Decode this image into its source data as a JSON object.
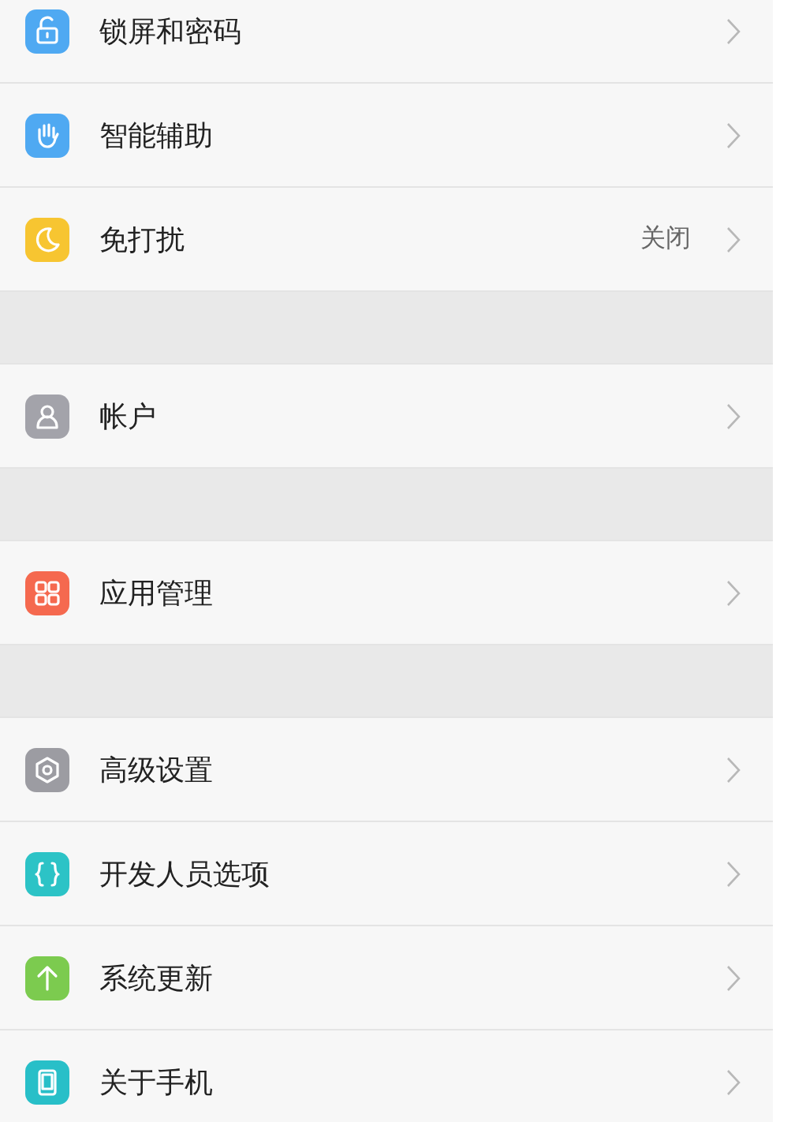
{
  "groups": [
    {
      "items": [
        {
          "label": "锁屏和密码",
          "color": "#4fa9f2"
        },
        {
          "label": "智能辅助",
          "color": "#4fa9f2"
        },
        {
          "label": "免打扰",
          "color": "#f7c531",
          "value": "关闭"
        }
      ]
    },
    {
      "items": [
        {
          "label": "帐户",
          "color": "#a3a3aa"
        }
      ]
    },
    {
      "items": [
        {
          "label": "应用管理",
          "color": "#f5694f"
        }
      ]
    },
    {
      "items": [
        {
          "label": "高级设置",
          "color": "#9c9ca2"
        },
        {
          "label": "开发人员选项",
          "color": "#2cc3c6"
        },
        {
          "label": "系统更新",
          "color": "#7ccb4f"
        },
        {
          "label": "关于手机",
          "color": "#28bfc8"
        }
      ]
    }
  ]
}
